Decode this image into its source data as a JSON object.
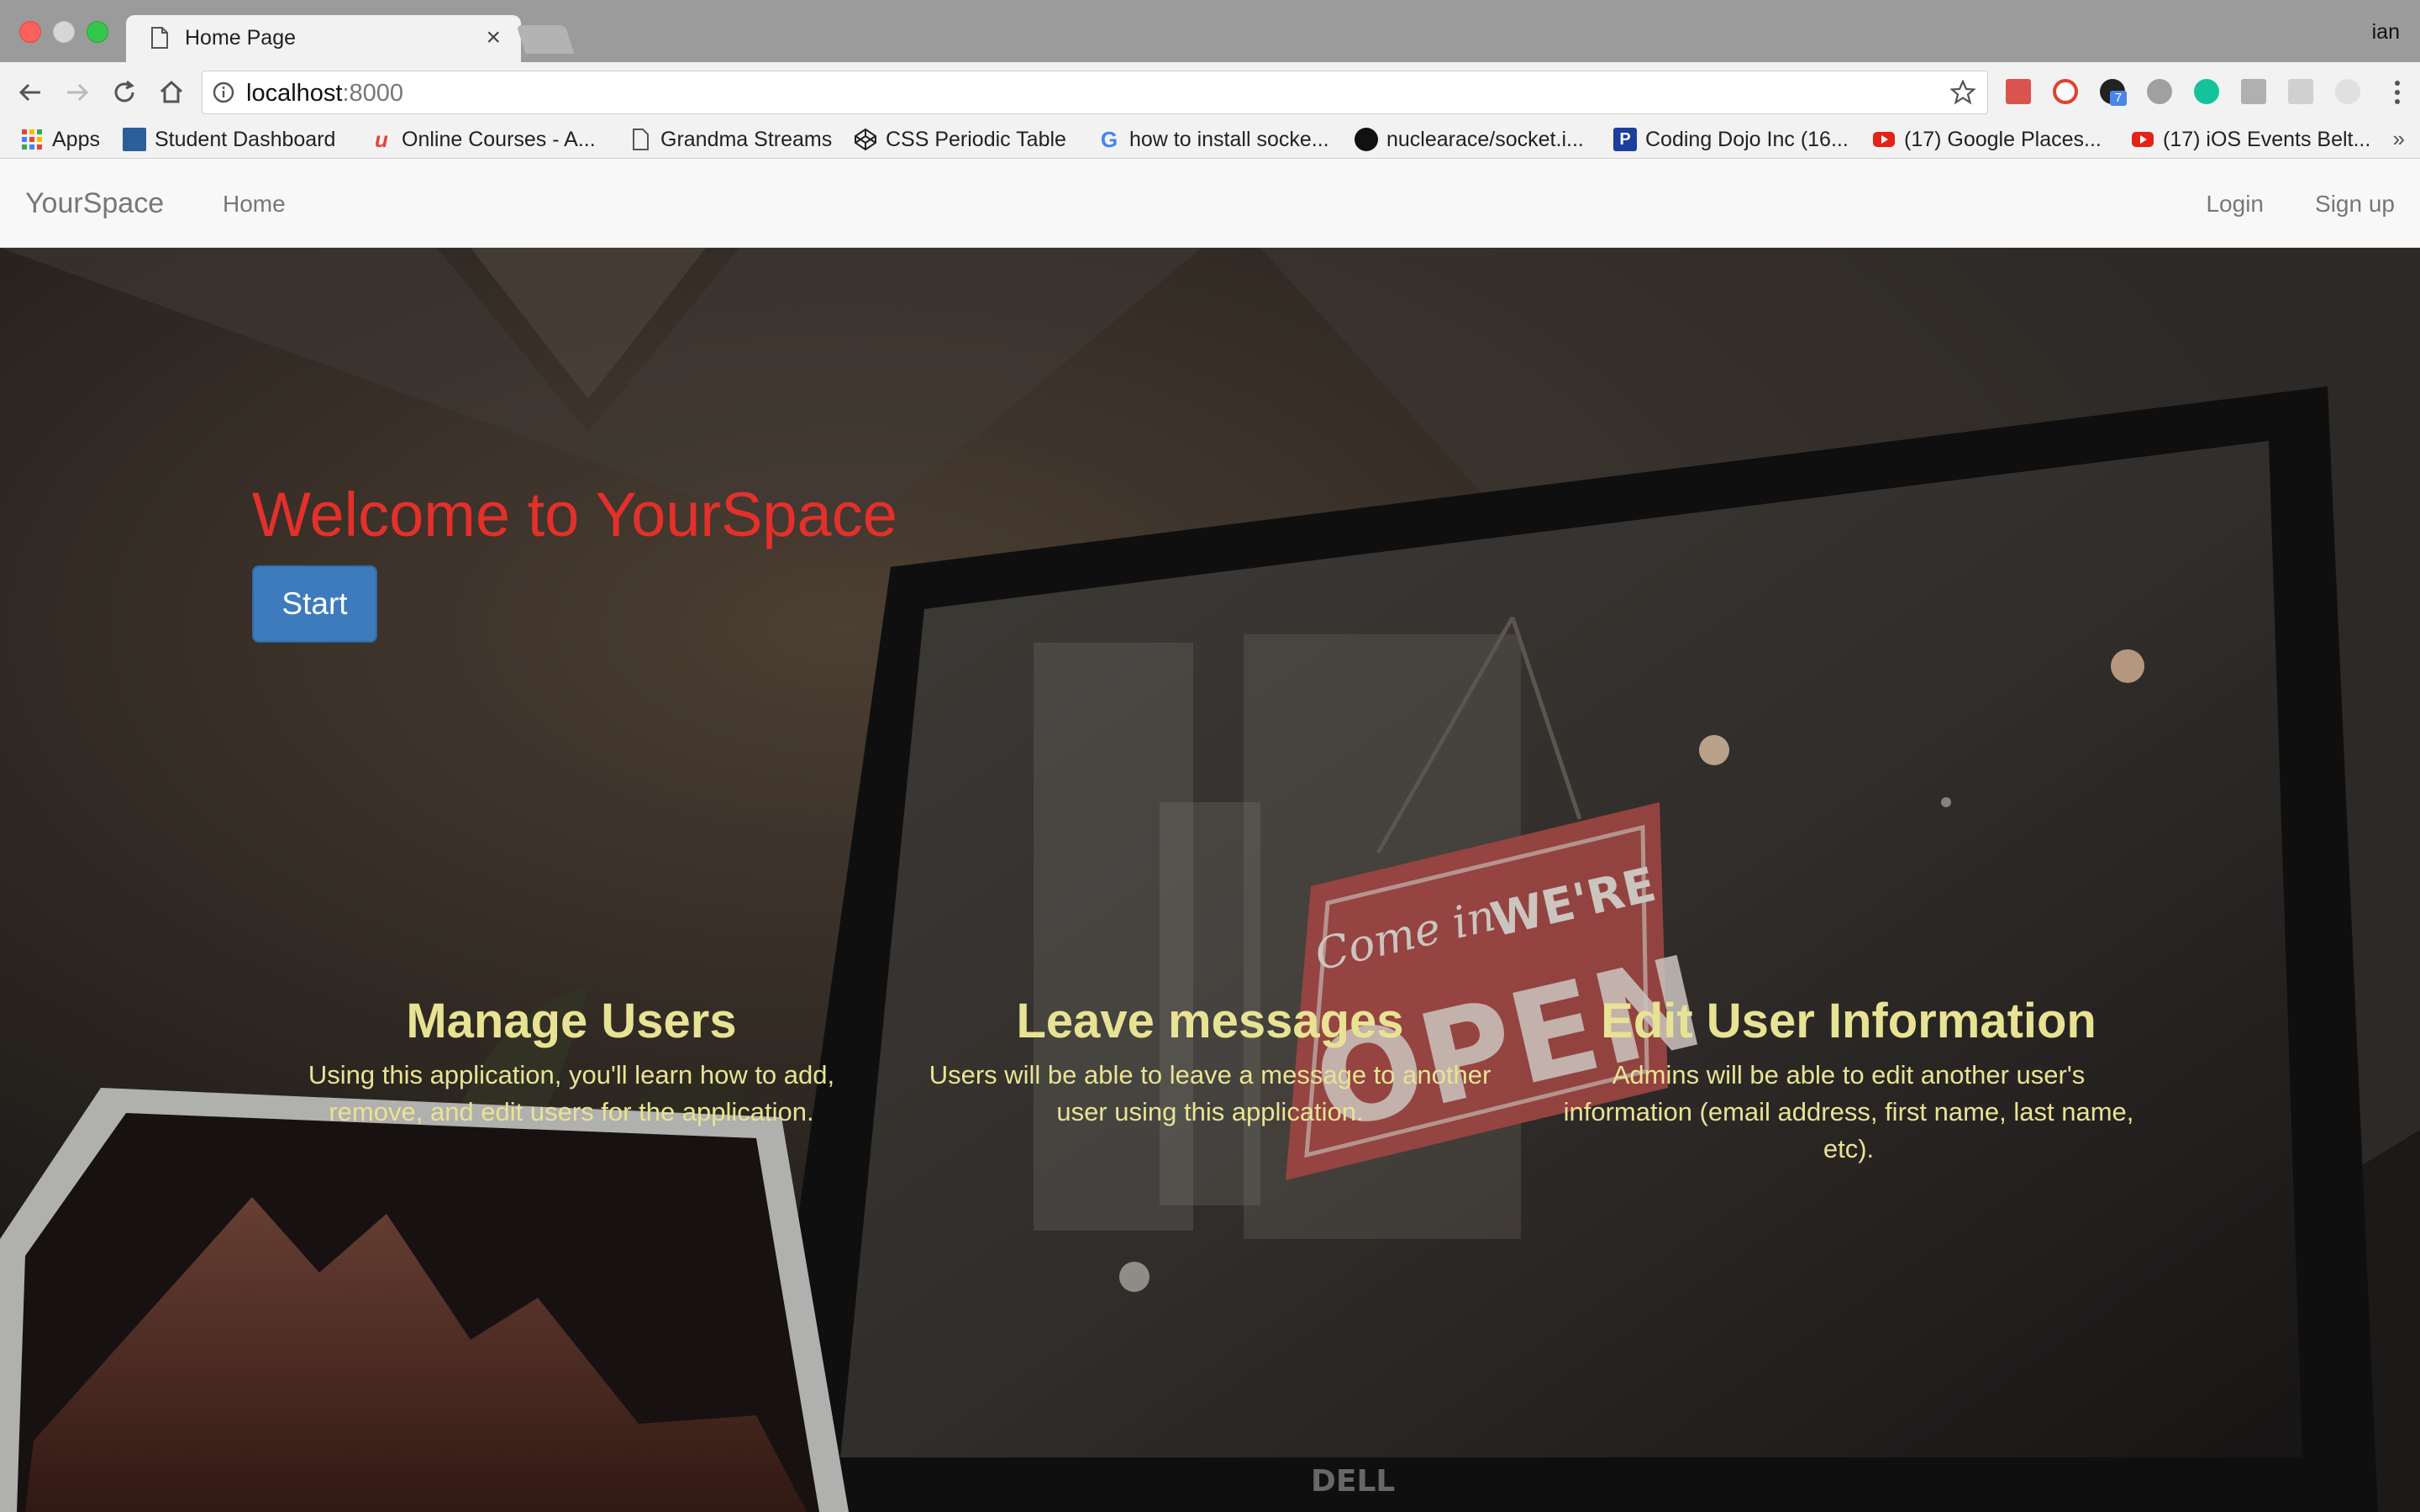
{
  "browser": {
    "tab_title": "Home Page",
    "tab_close": "×",
    "profile_name": "ian",
    "url_host": "localhost",
    "url_port": ":8000",
    "bookmarks": [
      {
        "label": "Apps",
        "icon": "apps-grid-icon"
      },
      {
        "label": "Student Dashboard",
        "icon": "dashboard-gate-icon"
      },
      {
        "label": "Online Courses - A...",
        "icon": "udemy-icon"
      },
      {
        "label": "Grandma Streams",
        "icon": "document-icon"
      },
      {
        "label": "CSS Periodic Table",
        "icon": "codepen-icon"
      },
      {
        "label": "how to install socke...",
        "icon": "google-icon"
      },
      {
        "label": "nuclearace/socket.i...",
        "icon": "github-icon"
      },
      {
        "label": "Coding Dojo Inc (16...",
        "icon": "paylocity-icon"
      },
      {
        "label": "(17) Google Places...",
        "icon": "youtube-icon"
      },
      {
        "label": "(17) iOS Events Belt...",
        "icon": "youtube-icon"
      }
    ],
    "bookmarks_more": "»",
    "extension_badge": "7"
  },
  "navbar": {
    "brand": "YourSpace",
    "home": "Home",
    "login": "Login",
    "signup": "Sign up"
  },
  "hero": {
    "title": "Welcome to YourSpace",
    "start_button": "Start",
    "sign_text_1": "Come in",
    "sign_text_2": "WE'RE",
    "sign_text_3": "OPEN",
    "monitor_brand": "DELL"
  },
  "features": [
    {
      "title": "Manage Users",
      "text": "Using this application, you'll learn how to add, remove, and edit users for the application."
    },
    {
      "title": "Leave messages",
      "text": "Users will be able to leave a message to another user using this application."
    },
    {
      "title": "Edit User Information",
      "text": "Admins will be able to edit another user's information (email address, first name, last name, etc)."
    }
  ],
  "colors": {
    "hero_title": "#e4302b",
    "start_button": "#3d7bbd",
    "feature_text": "#e8e394",
    "navbar_bg": "#f8f8f8"
  }
}
